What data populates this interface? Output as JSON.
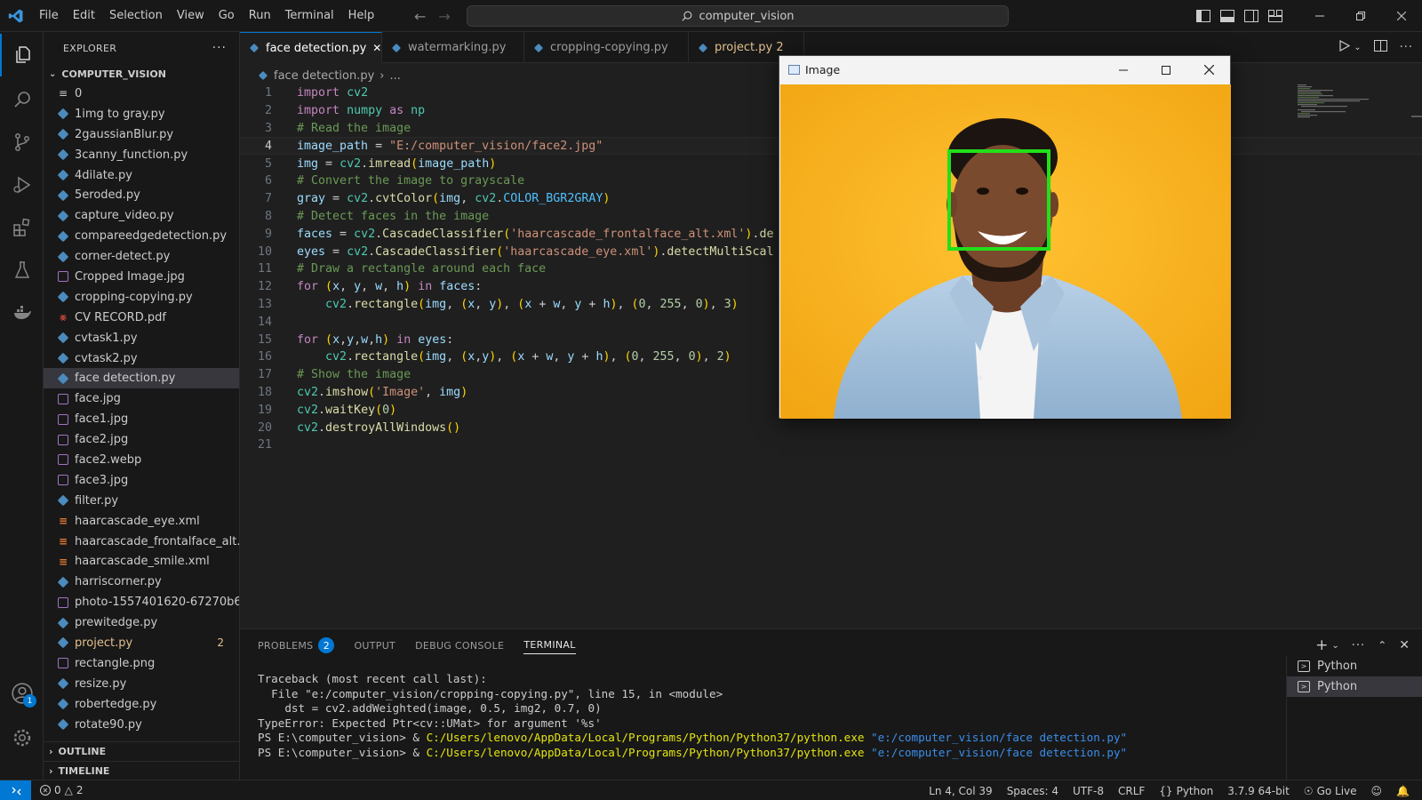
{
  "titlebar": {
    "menu": [
      "File",
      "Edit",
      "Selection",
      "View",
      "Go",
      "Run",
      "Terminal",
      "Help"
    ],
    "search_text": "computer_vision"
  },
  "explorer": {
    "header": "EXPLORER",
    "folder": "COMPUTER_VISION",
    "files": [
      {
        "name": "0",
        "type": "lines"
      },
      {
        "name": "1img to gray.py",
        "type": "py"
      },
      {
        "name": "2gaussianBlur.py",
        "type": "py"
      },
      {
        "name": "3canny_function.py",
        "type": "py"
      },
      {
        "name": "4dilate.py",
        "type": "py"
      },
      {
        "name": "5eroded.py",
        "type": "py"
      },
      {
        "name": "capture_video.py",
        "type": "py"
      },
      {
        "name": "compareedgedetection.py",
        "type": "py"
      },
      {
        "name": "corner-detect.py",
        "type": "py"
      },
      {
        "name": "Cropped Image.jpg",
        "type": "img"
      },
      {
        "name": "cropping-copying.py",
        "type": "py"
      },
      {
        "name": "CV RECORD.pdf",
        "type": "pdf"
      },
      {
        "name": "cvtask1.py",
        "type": "py"
      },
      {
        "name": "cvtask2.py",
        "type": "py"
      },
      {
        "name": "face detection.py",
        "type": "py",
        "selected": true
      },
      {
        "name": "face.jpg",
        "type": "img"
      },
      {
        "name": "face1.jpg",
        "type": "img"
      },
      {
        "name": "face2.jpg",
        "type": "img"
      },
      {
        "name": "face2.webp",
        "type": "img"
      },
      {
        "name": "face3.jpg",
        "type": "img"
      },
      {
        "name": "filter.py",
        "type": "py"
      },
      {
        "name": "haarcascade_eye.xml",
        "type": "xml"
      },
      {
        "name": "haarcascade_frontalface_alt.x...",
        "type": "xml"
      },
      {
        "name": "haarcascade_smile.xml",
        "type": "xml"
      },
      {
        "name": "harriscorner.py",
        "type": "py"
      },
      {
        "name": "photo-1557401620-67270b6...",
        "type": "img"
      },
      {
        "name": "prewitedge.py",
        "type": "py"
      },
      {
        "name": "project.py",
        "type": "py",
        "modified": true,
        "count": "2"
      },
      {
        "name": "rectangle.png",
        "type": "img"
      },
      {
        "name": "resize.py",
        "type": "py"
      },
      {
        "name": "robertedge.py",
        "type": "py"
      },
      {
        "name": "rotate90.py",
        "type": "py"
      }
    ],
    "outline": "OUTLINE",
    "timeline": "TIMELINE"
  },
  "tabs": [
    {
      "label": "face detection.py",
      "active": true
    },
    {
      "label": "watermarking.py"
    },
    {
      "label": "cropping-copying.py"
    },
    {
      "label": "project.py 2",
      "modified": true
    }
  ],
  "breadcrumb": {
    "file": "face detection.py",
    "rest": "..."
  },
  "code": {
    "current_line": 4,
    "lines": [
      "import cv2",
      "import numpy as np",
      "# Read the image",
      "image_path = \"E:/computer_vision/face2.jpg\"",
      "img = cv2.imread(image_path)",
      "# Convert the image to grayscale",
      "gray = cv2.cvtColor(img, cv2.COLOR_BGR2GRAY)",
      "# Detect faces in the image",
      "faces = cv2.CascadeClassifier('haarcascade_frontalface_alt.xml').de",
      "eyes = cv2.CascadeClassifier('haarcascade_eye.xml').detectMultiScal",
      "# Draw a rectangle around each face",
      "for (x, y, w, h) in faces:",
      "    cv2.rectangle(img, (x, y), (x + w, y + h), (0, 255, 0), 3)",
      "",
      "for (x,y,w,h) in eyes:",
      "    cv2.rectangle(img, (x,y), (x + w, y + h), (0, 255, 0), 2)",
      "# Show the image",
      "cv2.imshow('Image', img)",
      "cv2.waitKey(0)",
      "cv2.destroyAllWindows()",
      ""
    ]
  },
  "image_window": {
    "title": "Image"
  },
  "panel": {
    "tabs": [
      {
        "label": "PROBLEMS",
        "badge": "2"
      },
      {
        "label": "OUTPUT"
      },
      {
        "label": "DEBUG CONSOLE"
      },
      {
        "label": "TERMINAL",
        "active": true
      }
    ],
    "terminal_lines": [
      {
        "text": "Traceback (most recent call last):"
      },
      {
        "text": "  File \"e:/computer_vision/cropping-copying.py\", line 15, in <module>"
      },
      {
        "text": "    dst = cv2.addWeighted(image, 0.5, img2, 0.7, 0)"
      },
      {
        "text": "TypeError: Expected Ptr<cv::UMat> for argument '%s'"
      },
      {
        "prompt": "PS E:\\computer_vision> & ",
        "exe": "C:/Users/lenovo/AppData/Local/Programs/Python/Python37/python.exe",
        "arg": " \"e:/computer_vision/face detection.py\""
      },
      {
        "prompt": "PS E:\\computer_vision> & ",
        "exe": "C:/Users/lenovo/AppData/Local/Programs/Python/Python37/python.exe",
        "arg": " \"e:/computer_vision/face detection.py\""
      }
    ],
    "terminals": [
      "Python",
      "Python"
    ]
  },
  "statusbar": {
    "errors": "0",
    "warnings": "2",
    "position": "Ln 4, Col 39",
    "spaces": "Spaces: 4",
    "encoding": "UTF-8",
    "eol": "CRLF",
    "language": "Python",
    "interpreter": "3.7.9 64-bit",
    "golive": "Go Live"
  },
  "colors": {
    "accent": "#0078d4",
    "green_box": "#22e01a",
    "backdrop": "#f5a623"
  }
}
